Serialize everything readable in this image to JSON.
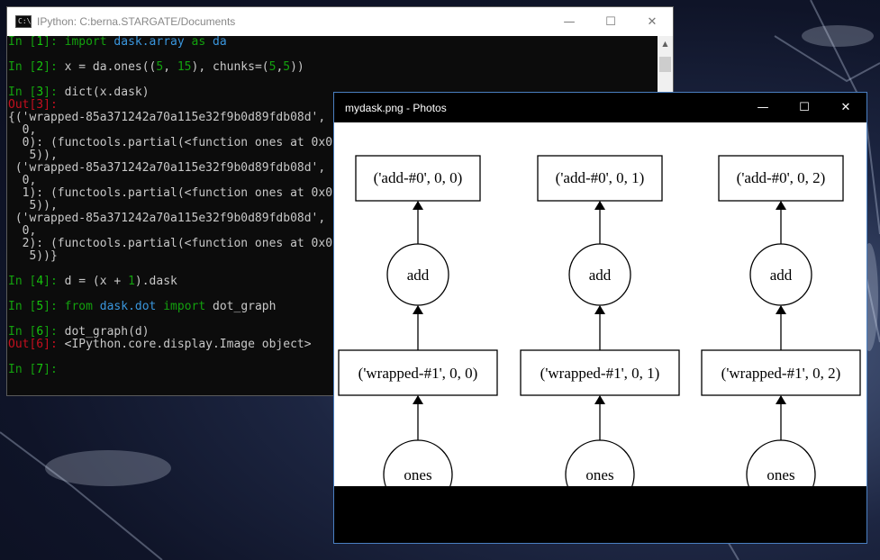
{
  "console": {
    "title": "IPython: C:berna.STARGATE/Documents",
    "app_icon": "C:\\",
    "lines": [
      [
        {
          "t": "In [",
          "c": "pin"
        },
        {
          "t": "1",
          "c": "pnum"
        },
        {
          "t": "]: ",
          "c": "pin"
        },
        {
          "t": "import",
          "c": "pin"
        },
        {
          "t": " dask.array ",
          "c": "kw"
        },
        {
          "t": "as",
          "c": "pin"
        },
        {
          "t": " da",
          "c": "kw"
        }
      ],
      [],
      [
        {
          "t": "In [",
          "c": "pin"
        },
        {
          "t": "2",
          "c": "pnum"
        },
        {
          "t": "]: ",
          "c": "pin"
        },
        {
          "t": "x = da.ones((",
          "c": ""
        },
        {
          "t": "5",
          "c": "num"
        },
        {
          "t": ", ",
          "c": ""
        },
        {
          "t": "15",
          "c": "num"
        },
        {
          "t": "), chunks=(",
          "c": ""
        },
        {
          "t": "5",
          "c": "num"
        },
        {
          "t": ",",
          "c": ""
        },
        {
          "t": "5",
          "c": "num"
        },
        {
          "t": "))",
          "c": ""
        }
      ],
      [],
      [
        {
          "t": "In [",
          "c": "pin"
        },
        {
          "t": "3",
          "c": "pnum"
        },
        {
          "t": "]: ",
          "c": "pin"
        },
        {
          "t": "dict(x.dask)",
          "c": ""
        }
      ],
      [
        {
          "t": "Out[3]:",
          "c": "pout"
        }
      ],
      [
        {
          "t": "{('wrapped-85a371242a70a115e32f9b0d89fdb08d',",
          "c": ""
        }
      ],
      [
        {
          "t": "  0,",
          "c": ""
        }
      ],
      [
        {
          "t": "  0): (functools.partial(<function ones at 0x0",
          "c": ""
        }
      ],
      [
        {
          "t": "   5)),",
          "c": ""
        }
      ],
      [
        {
          "t": " ('wrapped-85a371242a70a115e32f9b0d89fdb08d',",
          "c": ""
        }
      ],
      [
        {
          "t": "  0,",
          "c": ""
        }
      ],
      [
        {
          "t": "  1): (functools.partial(<function ones at 0x0",
          "c": ""
        }
      ],
      [
        {
          "t": "   5)),",
          "c": ""
        }
      ],
      [
        {
          "t": " ('wrapped-85a371242a70a115e32f9b0d89fdb08d',",
          "c": ""
        }
      ],
      [
        {
          "t": "  0,",
          "c": ""
        }
      ],
      [
        {
          "t": "  2): (functools.partial(<function ones at 0x0",
          "c": ""
        }
      ],
      [
        {
          "t": "   5))}",
          "c": ""
        }
      ],
      [],
      [
        {
          "t": "In [",
          "c": "pin"
        },
        {
          "t": "4",
          "c": "pnum"
        },
        {
          "t": "]: ",
          "c": "pin"
        },
        {
          "t": "d = (x + ",
          "c": ""
        },
        {
          "t": "1",
          "c": "num"
        },
        {
          "t": ").dask",
          "c": ""
        }
      ],
      [],
      [
        {
          "t": "In [",
          "c": "pin"
        },
        {
          "t": "5",
          "c": "pnum"
        },
        {
          "t": "]: ",
          "c": "pin"
        },
        {
          "t": "from",
          "c": "pin"
        },
        {
          "t": " dask.dot ",
          "c": "kw"
        },
        {
          "t": "import",
          "c": "pin"
        },
        {
          "t": " dot_graph",
          "c": ""
        }
      ],
      [],
      [
        {
          "t": "In [",
          "c": "pin"
        },
        {
          "t": "6",
          "c": "pnum"
        },
        {
          "t": "]: ",
          "c": "pin"
        },
        {
          "t": "dot_graph(d)",
          "c": ""
        }
      ],
      [
        {
          "t": "Out[6]: ",
          "c": "pout"
        },
        {
          "t": "<IPython.core.display.Image object>",
          "c": ""
        }
      ],
      [],
      [
        {
          "t": "In [",
          "c": "pin"
        },
        {
          "t": "7",
          "c": "pnum"
        },
        {
          "t": "]:",
          "c": "pin"
        }
      ]
    ]
  },
  "photos": {
    "title": "mydask.png - Photos",
    "graph": {
      "columns": [
        {
          "top": "('add-#0', 0, 0)",
          "op": "add",
          "mid": "('wrapped-#1', 0, 0)",
          "bottom": "ones"
        },
        {
          "top": "('add-#0', 0, 1)",
          "op": "add",
          "mid": "('wrapped-#1', 0, 1)",
          "bottom": "ones"
        },
        {
          "top": "('add-#0', 0, 2)",
          "op": "add",
          "mid": "('wrapped-#1', 0, 2)",
          "bottom": "ones"
        }
      ]
    }
  },
  "window_buttons": {
    "minimize": "—",
    "maximize": "☐",
    "close": "✕"
  },
  "colors": {
    "prompt_in": "#13a10e",
    "prompt_out": "#c50f1f",
    "keyword": "#3a96dd",
    "accent_border": "#4a7fc1"
  }
}
